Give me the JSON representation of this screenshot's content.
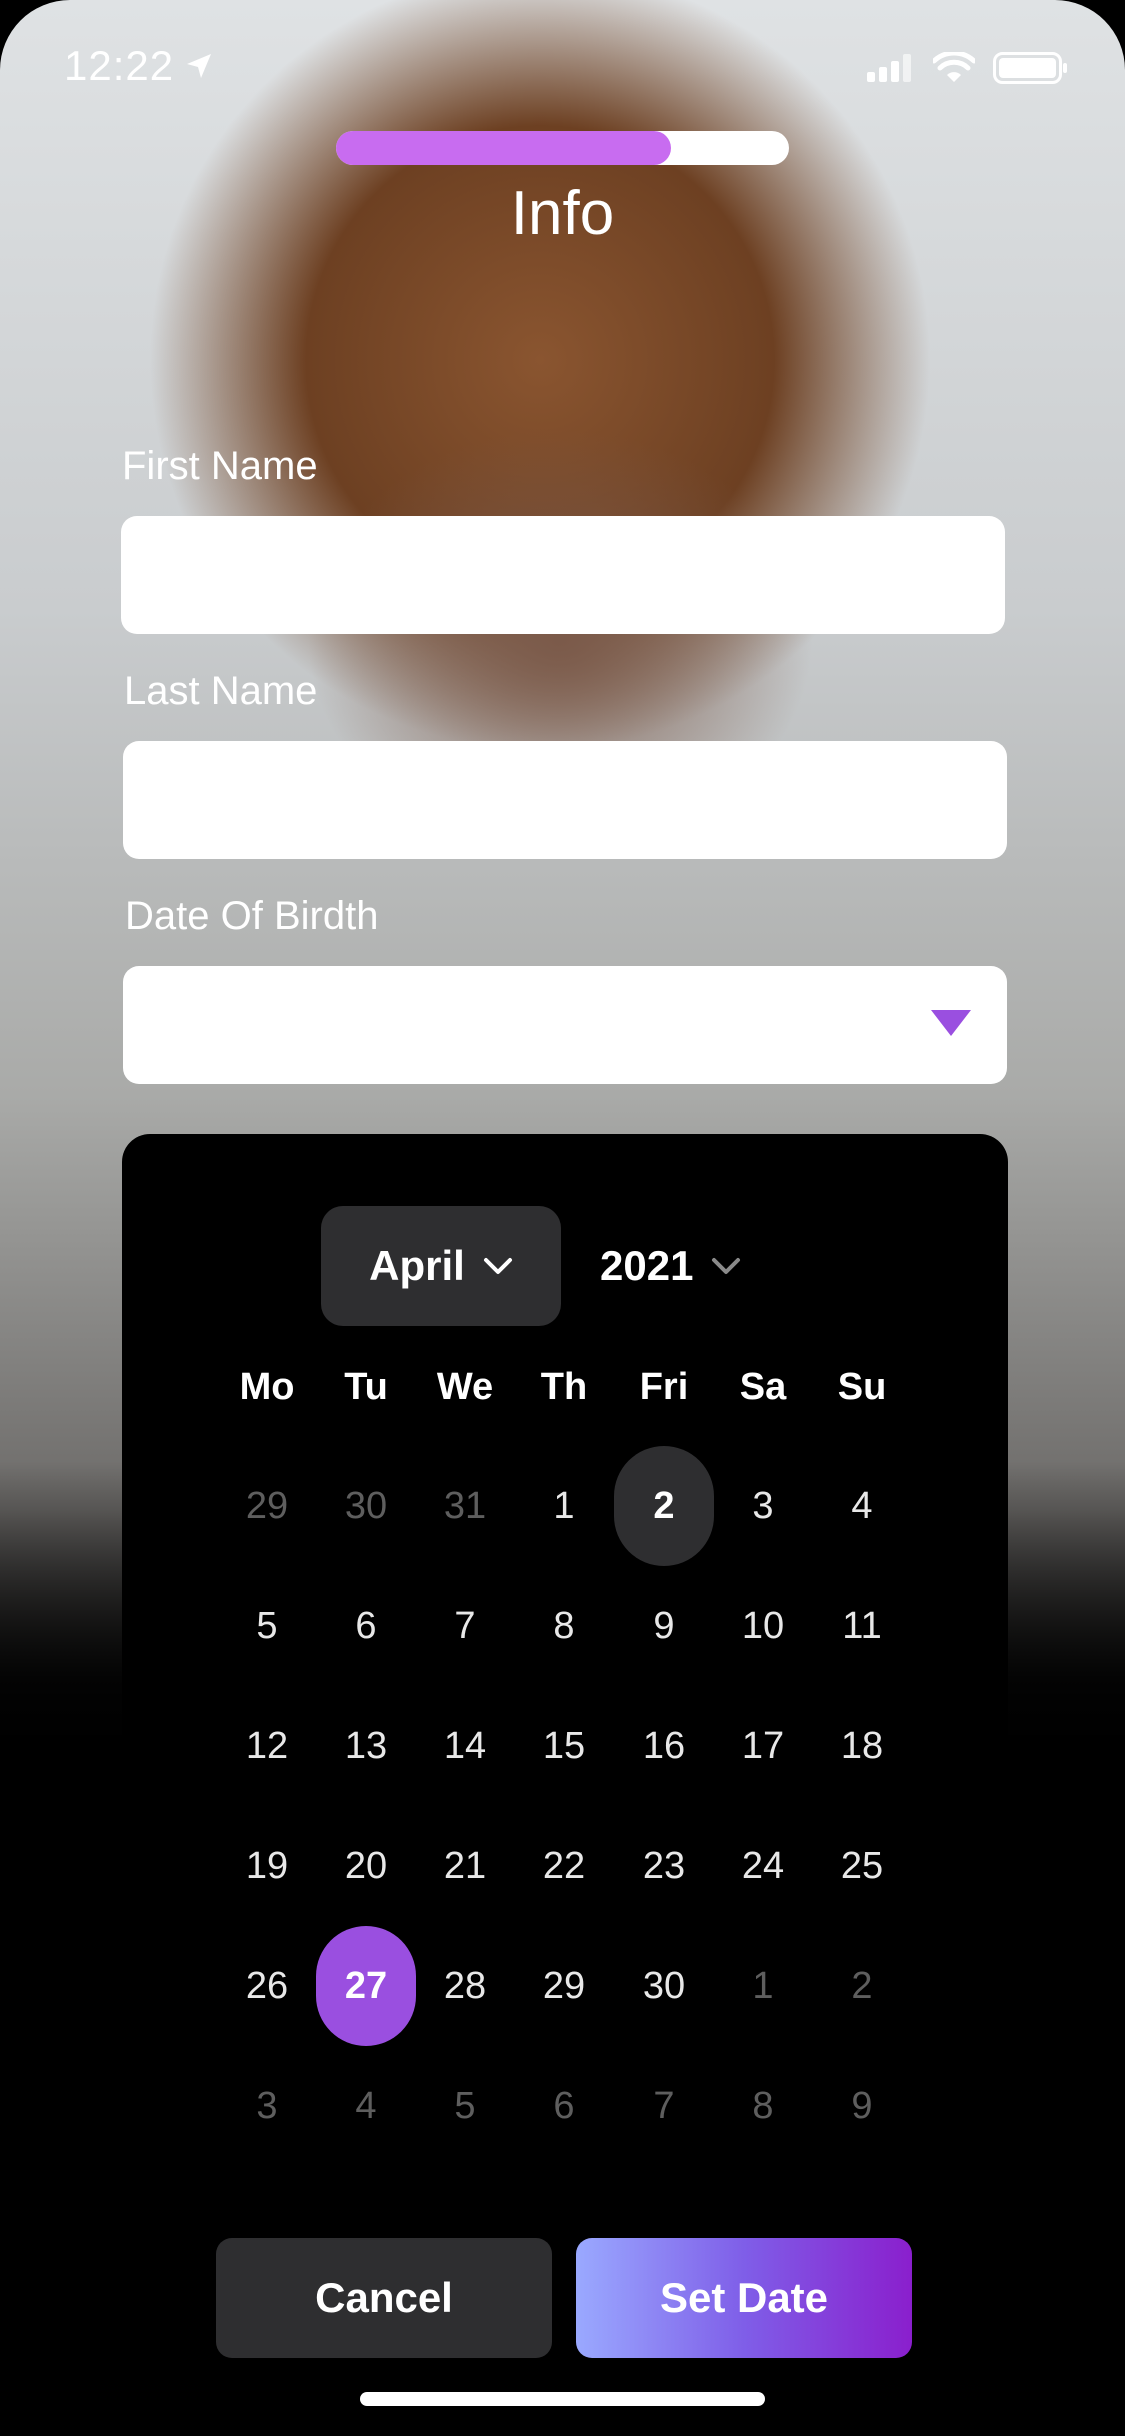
{
  "status_bar": {
    "time": "12:22"
  },
  "progress": {
    "fraction": 0.74
  },
  "header": {
    "title": "Info"
  },
  "form": {
    "first_name_label": "First Name",
    "first_name_value": "",
    "last_name_label": "Last Name",
    "last_name_value": "",
    "dob_label": "Date Of Birdth",
    "dob_value": ""
  },
  "calendar": {
    "month": "April",
    "year": "2021",
    "weekdays": [
      "Mo",
      "Tu",
      "We",
      "Th",
      "Fri",
      "Sa",
      "Su"
    ],
    "weeks": [
      [
        {
          "d": "29",
          "m": true
        },
        {
          "d": "30",
          "m": true
        },
        {
          "d": "31",
          "m": true
        },
        {
          "d": "1"
        },
        {
          "d": "2",
          "today": true
        },
        {
          "d": "3"
        },
        {
          "d": "4"
        }
      ],
      [
        {
          "d": "5"
        },
        {
          "d": "6"
        },
        {
          "d": "7"
        },
        {
          "d": "8"
        },
        {
          "d": "9"
        },
        {
          "d": "10"
        },
        {
          "d": "11"
        }
      ],
      [
        {
          "d": "12"
        },
        {
          "d": "13"
        },
        {
          "d": "14"
        },
        {
          "d": "15"
        },
        {
          "d": "16"
        },
        {
          "d": "17"
        },
        {
          "d": "18"
        }
      ],
      [
        {
          "d": "19"
        },
        {
          "d": "20"
        },
        {
          "d": "21"
        },
        {
          "d": "22"
        },
        {
          "d": "23"
        },
        {
          "d": "24"
        },
        {
          "d": "25"
        }
      ],
      [
        {
          "d": "26"
        },
        {
          "d": "27",
          "selected": true
        },
        {
          "d": "28"
        },
        {
          "d": "29"
        },
        {
          "d": "30"
        },
        {
          "d": "1",
          "m": true
        },
        {
          "d": "2",
          "m": true
        }
      ],
      [
        {
          "d": "3",
          "m": true
        },
        {
          "d": "4",
          "m": true
        },
        {
          "d": "5",
          "m": true
        },
        {
          "d": "6",
          "m": true
        },
        {
          "d": "7",
          "m": true
        },
        {
          "d": "8",
          "m": true
        },
        {
          "d": "9",
          "m": true
        }
      ]
    ]
  },
  "actions": {
    "cancel_label": "Cancel",
    "set_label": "Set Date"
  },
  "colors": {
    "accent": "#9a4fe0",
    "progress": "#c86cf0",
    "muted_day": "#5e5e5e"
  }
}
